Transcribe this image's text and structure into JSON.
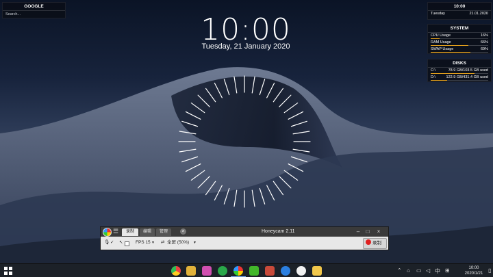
{
  "google_widget": {
    "title": "GOOGLE",
    "search_placeholder": "Search..."
  },
  "clock": {
    "time": "10:00",
    "date": "Tuesday, 21 January 2020"
  },
  "clock_widget": {
    "title": "10:00",
    "day": "Tuesday",
    "date": "21.01.2020"
  },
  "system_widget": {
    "title": "SYSTEM",
    "rows": [
      {
        "label": "CPU Usage",
        "value": "16%",
        "level": 0.16
      },
      {
        "label": "RAM Usage",
        "value": "66%",
        "level": 0.66
      },
      {
        "label": "SWAP Usage",
        "value": "69%",
        "level": 0.69
      }
    ]
  },
  "disks_widget": {
    "title": "DISKS",
    "rows": [
      {
        "label": "C:\\",
        "value": "78.9 GB/103.5 GB used",
        "level": 0.76
      },
      {
        "label": "D:\\",
        "value": "122.9 GB/431.4 GB used",
        "level": 0.28
      }
    ]
  },
  "honeycam": {
    "title": "Honeycam 2.11",
    "tabs": [
      "录制",
      "编辑",
      "管理"
    ],
    "fps_label": "FPS 15",
    "size_label": "全屏 (50%)",
    "record_label": "录制",
    "colors": {
      "record": "#e02020"
    }
  },
  "taskbar": {
    "icons": [
      "windows-start-icon",
      "chrome-icon",
      "paint-icon",
      "git-icon",
      "media-icon",
      "honeycam-icon",
      "wechat-icon",
      "presentation-icon",
      "edge-icon",
      "network-tool-icon",
      "folder-icon"
    ],
    "tray": {
      "ime": "中",
      "time": "10:00",
      "date": "2020/1/21"
    }
  }
}
